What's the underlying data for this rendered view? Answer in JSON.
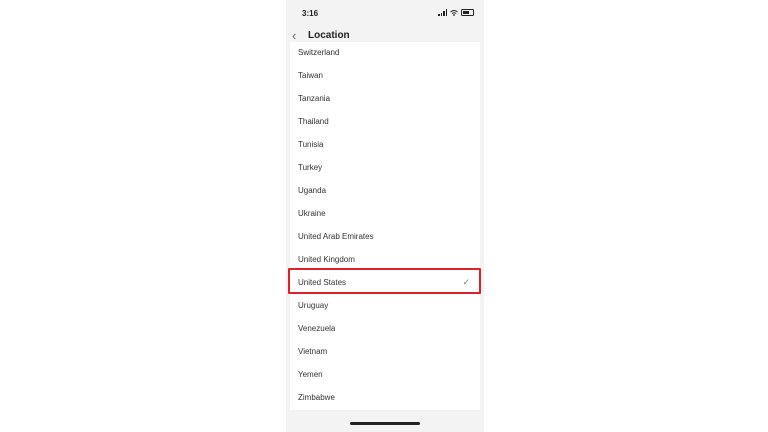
{
  "status": {
    "time": "3:16"
  },
  "header": {
    "title": "Location",
    "back_icon": "chevron-left-icon"
  },
  "countries": [
    {
      "label": "Switzerland",
      "selected": false
    },
    {
      "label": "Taiwan",
      "selected": false
    },
    {
      "label": "Tanzania",
      "selected": false
    },
    {
      "label": "Thailand",
      "selected": false
    },
    {
      "label": "Tunisia",
      "selected": false
    },
    {
      "label": "Turkey",
      "selected": false
    },
    {
      "label": "Uganda",
      "selected": false
    },
    {
      "label": "Ukraine",
      "selected": false
    },
    {
      "label": "United Arab Emirates",
      "selected": false
    },
    {
      "label": "United Kingdom",
      "selected": false
    },
    {
      "label": "United States",
      "selected": true
    },
    {
      "label": "Uruguay",
      "selected": false
    },
    {
      "label": "Venezuela",
      "selected": false
    },
    {
      "label": "Vietnam",
      "selected": false
    },
    {
      "label": "Yemen",
      "selected": false
    },
    {
      "label": "Zimbabwe",
      "selected": false
    }
  ],
  "colors": {
    "highlight": "#e0202a",
    "check": "#888888"
  }
}
